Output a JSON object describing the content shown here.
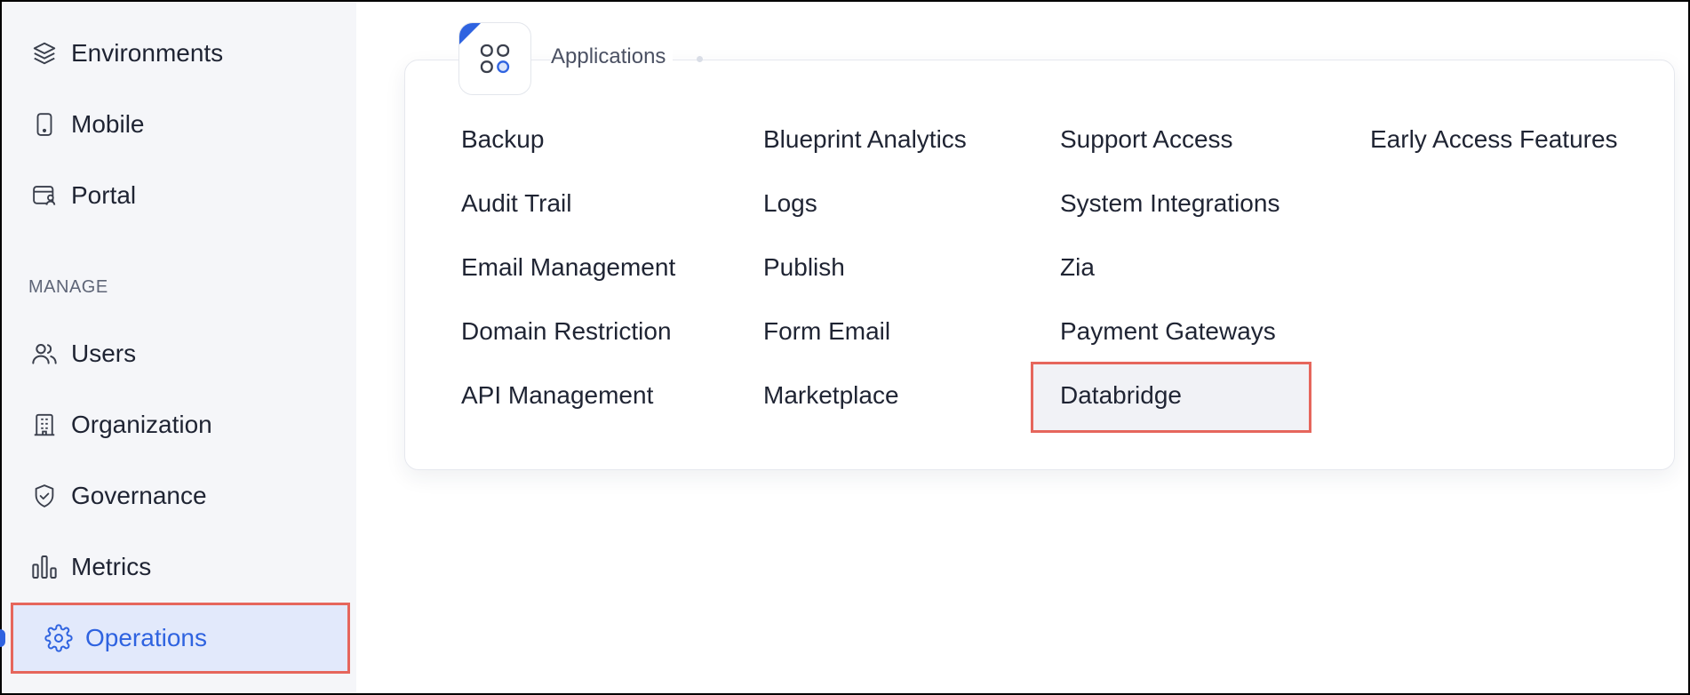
{
  "sidebar": {
    "items_top": [
      {
        "label": "Environments",
        "icon": "layers-icon"
      },
      {
        "label": "Mobile",
        "icon": "mobile-icon"
      },
      {
        "label": "Portal",
        "icon": "portal-icon"
      }
    ],
    "section_label": "MANAGE",
    "items_manage": [
      {
        "label": "Users",
        "icon": "users-icon"
      },
      {
        "label": "Organization",
        "icon": "building-icon"
      },
      {
        "label": "Governance",
        "icon": "shield-icon"
      },
      {
        "label": "Metrics",
        "icon": "bar-chart-icon"
      },
      {
        "label": "Operations",
        "icon": "gear-icon",
        "active": true
      }
    ]
  },
  "main": {
    "section_title": "Applications",
    "section_icon": "apps-grid-icon",
    "columns": [
      [
        "Backup",
        "Audit Trail",
        "Email Management",
        "Domain Restriction",
        "API Management"
      ],
      [
        "Blueprint Analytics",
        "Logs",
        "Publish",
        "Form Email",
        "Marketplace"
      ],
      [
        "Support Access",
        "System Integrations",
        "Zia",
        "Payment Gateways",
        "Databridge"
      ],
      [
        "Early Access Features"
      ]
    ],
    "highlighted_item": "Databridge"
  },
  "colors": {
    "accent": "#2f63e0",
    "highlight_border": "#e6665c",
    "sidebar_bg": "#f5f6f9",
    "active_bg": "#e2e9fb"
  }
}
